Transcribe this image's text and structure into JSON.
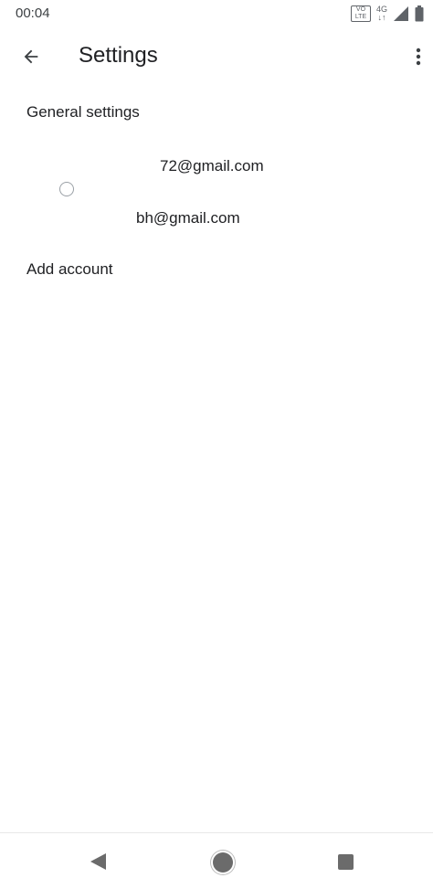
{
  "status_bar": {
    "time": "00:04",
    "volte_top": "VO",
    "volte_bottom": "LTE",
    "network_type": "4G",
    "network_arrows": "↓↑",
    "icons": [
      "volte-icon",
      "network-4g-icon",
      "signal-icon",
      "battery-icon"
    ]
  },
  "app_bar": {
    "title": "Settings",
    "back_icon": "arrow-back-icon",
    "more_icon": "more-vert-icon"
  },
  "settings": {
    "general_label": "General settings",
    "accounts": [
      {
        "email": "72@gmail.com"
      },
      {
        "email": "bh@gmail.com"
      }
    ],
    "add_account_label": "Add account"
  },
  "nav_bar": {
    "icons": [
      "nav-back-icon",
      "nav-home-icon",
      "nav-recents-icon"
    ]
  }
}
